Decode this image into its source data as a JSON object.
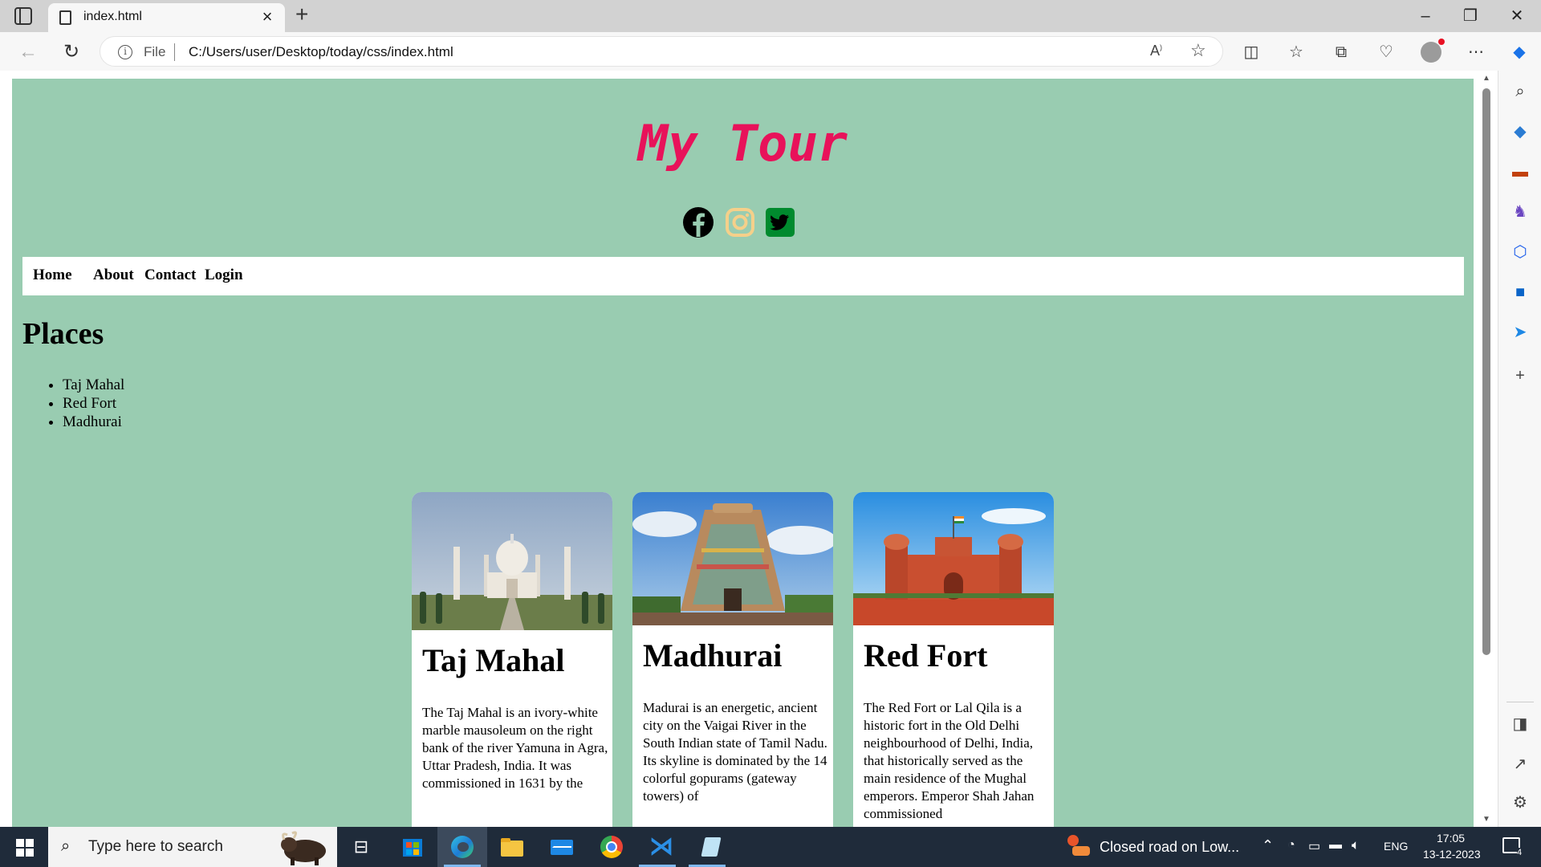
{
  "browser": {
    "tab_title": "index.html",
    "file_label": "File",
    "url": "C:/Users/user/Desktop/today/css/index.html"
  },
  "page": {
    "site_title": "My Tour",
    "nav": [
      "Home",
      "About",
      "Contact",
      "Login"
    ],
    "places_heading": "Places",
    "places": [
      "Taj Mahal",
      "Red Fort",
      "Madhurai"
    ],
    "cards": [
      {
        "title": "Taj Mahal",
        "text": "The Taj Mahal is an ivory-white marble mausoleum on the right bank of the river Yamuna in Agra, Uttar Pradesh, India. It was commissioned in 1631 by the"
      },
      {
        "title": "Madhurai",
        "text": "Madurai is an energetic, ancient city on the Vaigai River in the South Indian state of Tamil Nadu. Its skyline is dominated by the 14 colorful gopurams (gateway towers) of"
      },
      {
        "title": "Red Fort",
        "text": "The Red Fort or Lal Qila is a historic fort in the Old Delhi neighbourhood of Delhi, India, that historically served as the main residence of the Mughal emperors. Emperor Shah Jahan commissioned"
      }
    ]
  },
  "colors": {
    "page_background": "#99ccb1",
    "title": "#e8125a",
    "facebook": "#000000",
    "instagram": "#f5d08a",
    "twitter": "#008a2e"
  },
  "taskbar": {
    "search_placeholder": "Type here to search",
    "news": "Closed road on Low...",
    "language": "ENG",
    "time": "17:05",
    "date": "13-12-2023",
    "notification_count": "4"
  }
}
